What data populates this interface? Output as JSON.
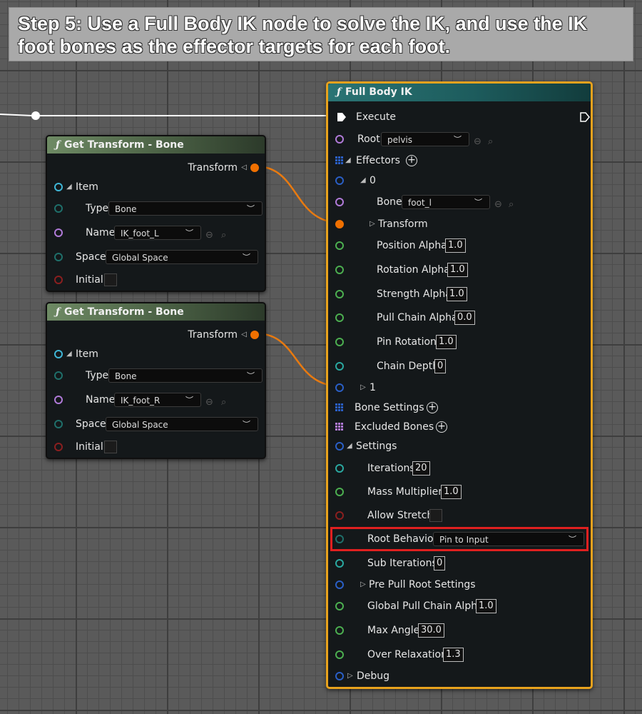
{
  "banner": {
    "text": "Step 5: Use a Full Body IK node to solve the IK, and use the IK foot bones as the effector targets for each foot."
  },
  "colors": {
    "fbik_border": "#e8a21d",
    "highlight": "#e02020",
    "wire_transform": "#e87a10",
    "wire_exec": "#ffffff"
  },
  "get_transform_nodes": [
    {
      "title": "Get Transform - Bone",
      "output": "Transform",
      "item": "Item",
      "type_label": "Type",
      "type_value": "Bone",
      "name_label": "Name",
      "name_value": "IK_foot_L",
      "space_label": "Space",
      "space_value": "Global Space",
      "initial_label": "Initial"
    },
    {
      "title": "Get Transform - Bone",
      "output": "Transform",
      "item": "Item",
      "type_label": "Type",
      "type_value": "Bone",
      "name_label": "Name",
      "name_value": "IK_foot_R",
      "space_label": "Space",
      "space_value": "Global Space",
      "initial_label": "Initial"
    }
  ],
  "fbik": {
    "title": "Full Body IK",
    "execute": "Execute",
    "root_label": "Root",
    "root_value": "pelvis",
    "effectors": "Effectors",
    "effector0": "0",
    "bone_label": "Bone",
    "bone_value": "foot_l",
    "transform": "Transform",
    "position_alpha": {
      "label": "Position Alpha",
      "value": "1.0"
    },
    "rotation_alpha": {
      "label": "Rotation Alpha",
      "value": "1.0"
    },
    "strength_alpha": {
      "label": "Strength Alpha",
      "value": "1.0"
    },
    "pull_chain_alpha": {
      "label": "Pull Chain Alpha",
      "value": "0.0"
    },
    "pin_rotation": {
      "label": "Pin Rotation",
      "value": "1.0"
    },
    "chain_depth": {
      "label": "Chain Depth",
      "value": "0"
    },
    "effector1": "1",
    "bone_settings": "Bone Settings",
    "excluded_bones": "Excluded Bones",
    "settings": "Settings",
    "iterations": {
      "label": "Iterations",
      "value": "20"
    },
    "mass_multiplier": {
      "label": "Mass Multiplier",
      "value": "1.0"
    },
    "allow_stretch": {
      "label": "Allow Stretch"
    },
    "root_behavior": {
      "label": "Root Behavior",
      "value": "Pin to Input"
    },
    "sub_iterations": {
      "label": "Sub Iterations",
      "value": "0"
    },
    "pre_pull_root": "Pre Pull Root Settings",
    "global_pull_chain_alpha": {
      "label": "Global Pull Chain Alpha",
      "value": "1.0"
    },
    "max_angle": {
      "label": "Max Angle",
      "value": "30.0"
    },
    "over_relaxation": {
      "label": "Over Relaxation",
      "value": "1.3"
    },
    "debug": "Debug"
  }
}
